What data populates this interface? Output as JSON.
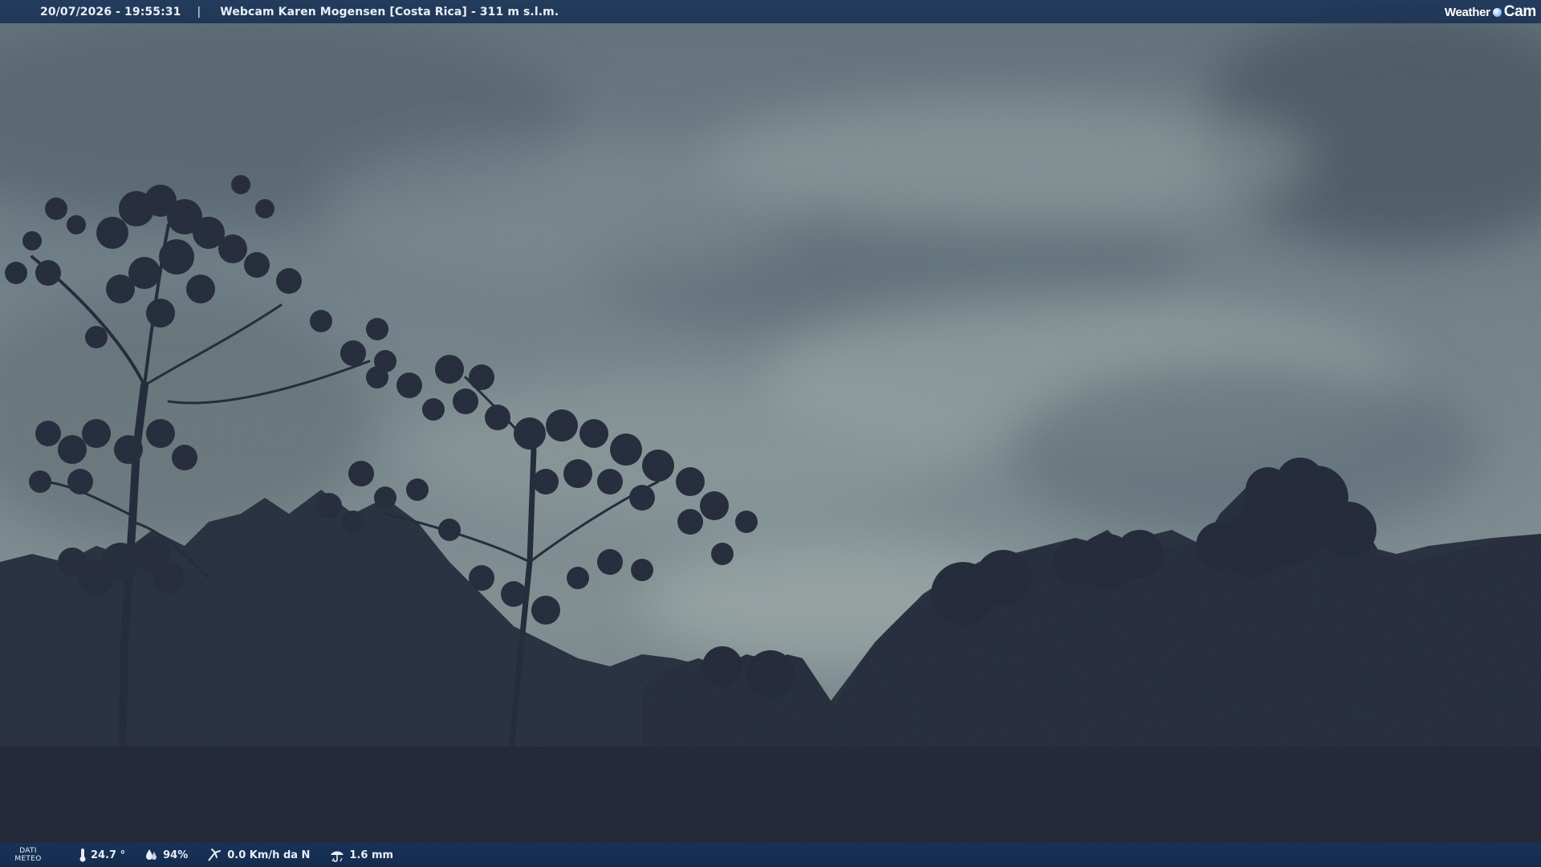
{
  "overlay_top": {
    "datetime": "20/07/2026 - 19:55:31",
    "separator": "|",
    "title": "Webcam Karen Mogensen [Costa Rica] - 311 m s.l.m."
  },
  "brand": {
    "word_weather": "Weather",
    "word_cam": "Cam"
  },
  "overlay_bottom": {
    "dati_line1": "DATI",
    "dati_line2": "METEO",
    "temperature": "24.7 °",
    "humidity": "94%",
    "wind": "0.0 Km/h da N",
    "rain": "1.6 mm",
    "icons": [
      "thermometer-icon",
      "humidity-icon",
      "wind-icon",
      "rain-icon"
    ]
  },
  "colors": {
    "sky_light": "#8a9aa0",
    "sky_dark": "#4a5a66",
    "forest": "#1c2232",
    "bar": "#1e3a5c"
  }
}
